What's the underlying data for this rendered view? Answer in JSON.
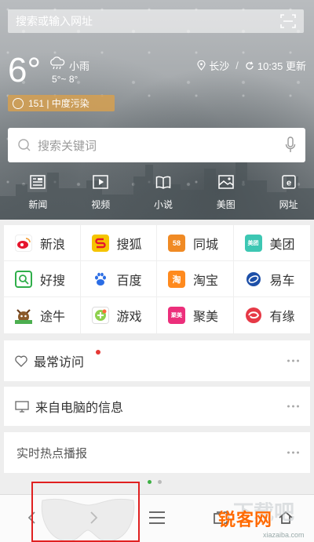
{
  "header": {
    "url_placeholder": "搜索或输入网址",
    "icon": "scan-icon"
  },
  "weather": {
    "temperature": "6°",
    "condition": "小雨",
    "range": "5°~ 8°",
    "city": "长沙",
    "updated": "10:35 更新",
    "aqi": "151 | 中度污染"
  },
  "search": {
    "placeholder": "搜索关键词"
  },
  "nav": [
    {
      "label": "新闻",
      "icon": "news-icon"
    },
    {
      "label": "视频",
      "icon": "video-icon"
    },
    {
      "label": "小说",
      "icon": "book-icon"
    },
    {
      "label": "美图",
      "icon": "image-icon"
    },
    {
      "label": "网址",
      "icon": "url-icon"
    }
  ],
  "sites": [
    {
      "label": "新浪",
      "color": "#e6162d",
      "icon": "sina-icon"
    },
    {
      "label": "搜狐",
      "color": "#f5c400",
      "icon": "sohu-icon"
    },
    {
      "label": "同城",
      "color": "#f08a24",
      "icon": "58-icon",
      "mark": "58"
    },
    {
      "label": "美团",
      "color": "#3dc7b3",
      "icon": "meituan-icon",
      "mark": "美团"
    },
    {
      "label": "好搜",
      "color": "#2fae4a",
      "icon": "haosou-icon"
    },
    {
      "label": "百度",
      "color": "#2b6de5",
      "icon": "baidu-icon"
    },
    {
      "label": "淘宝",
      "color": "#ff8a1e",
      "icon": "taobao-icon",
      "mark": "淘"
    },
    {
      "label": "易车",
      "color": "#1d4fa8",
      "icon": "yiche-icon"
    },
    {
      "label": "途牛",
      "color": "#4caf50",
      "icon": "tuniu-icon"
    },
    {
      "label": "游戏",
      "color": "#8fd14f",
      "icon": "game-icon"
    },
    {
      "label": "聚美",
      "color": "#ec2f7b",
      "icon": "jumei-icon",
      "mark": "聚美"
    },
    {
      "label": "有缘",
      "color": "#e63946",
      "icon": "youyuan-icon"
    }
  ],
  "cards": {
    "recent": "最常访问",
    "pc": "来自电脑的信息",
    "hot": "实时热点播报"
  },
  "pager": {
    "active_color": "#3cb043",
    "inactive_color": "#bbbbbb"
  },
  "watermark": {
    "text": "锐客网",
    "url": "xiazaiba.com"
  }
}
